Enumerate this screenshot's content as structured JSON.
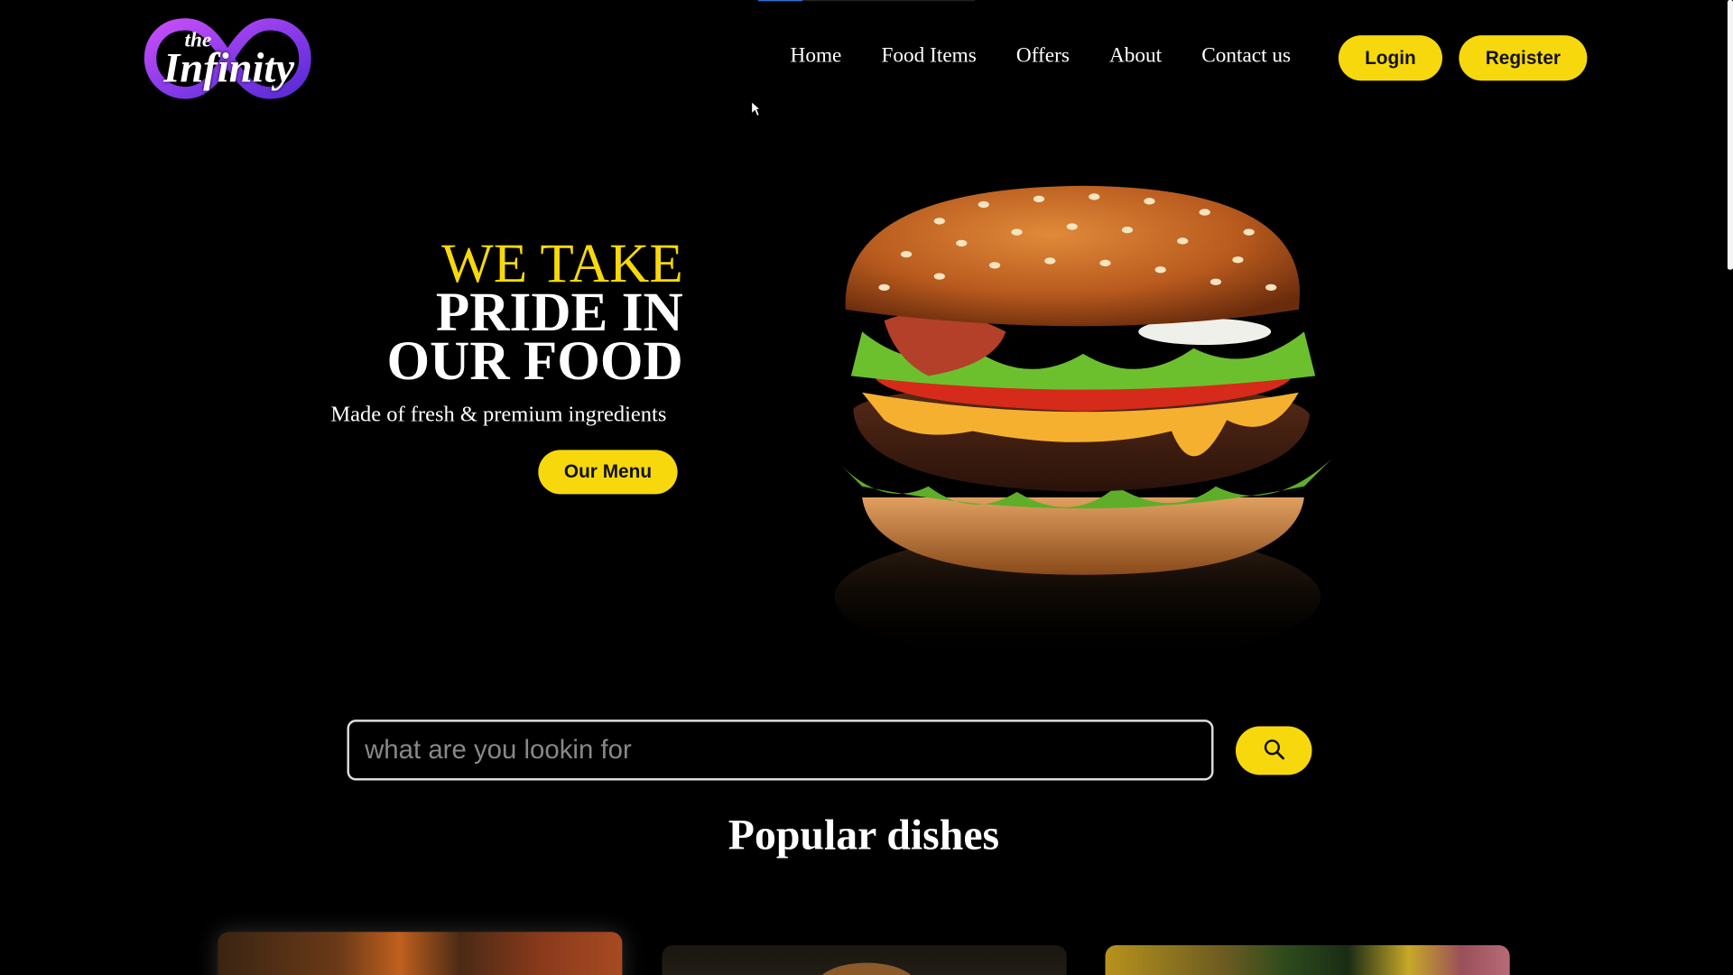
{
  "brand": {
    "the": "the",
    "name": "Infinity"
  },
  "nav": {
    "items": [
      "Home",
      "Food Items",
      "Offers",
      "About",
      "Contact us"
    ],
    "login_label": "Login",
    "register_label": "Register"
  },
  "hero": {
    "title_line1": "WE TAKE",
    "title_line2": "PRIDE IN",
    "title_line3": "OUR FOOD",
    "subtitle": "Made of fresh & premium ingredients",
    "menu_button": "Our Menu"
  },
  "search": {
    "placeholder": "what are you lookin for"
  },
  "popular": {
    "title": "Popular dishes"
  },
  "icons": {
    "search": "search-icon",
    "logo": "infinity-logo-icon",
    "cursor": "cursor-icon"
  },
  "colors": {
    "accent": "#f7d80c",
    "background": "#000000",
    "logo_purple": "#9b3df0"
  }
}
